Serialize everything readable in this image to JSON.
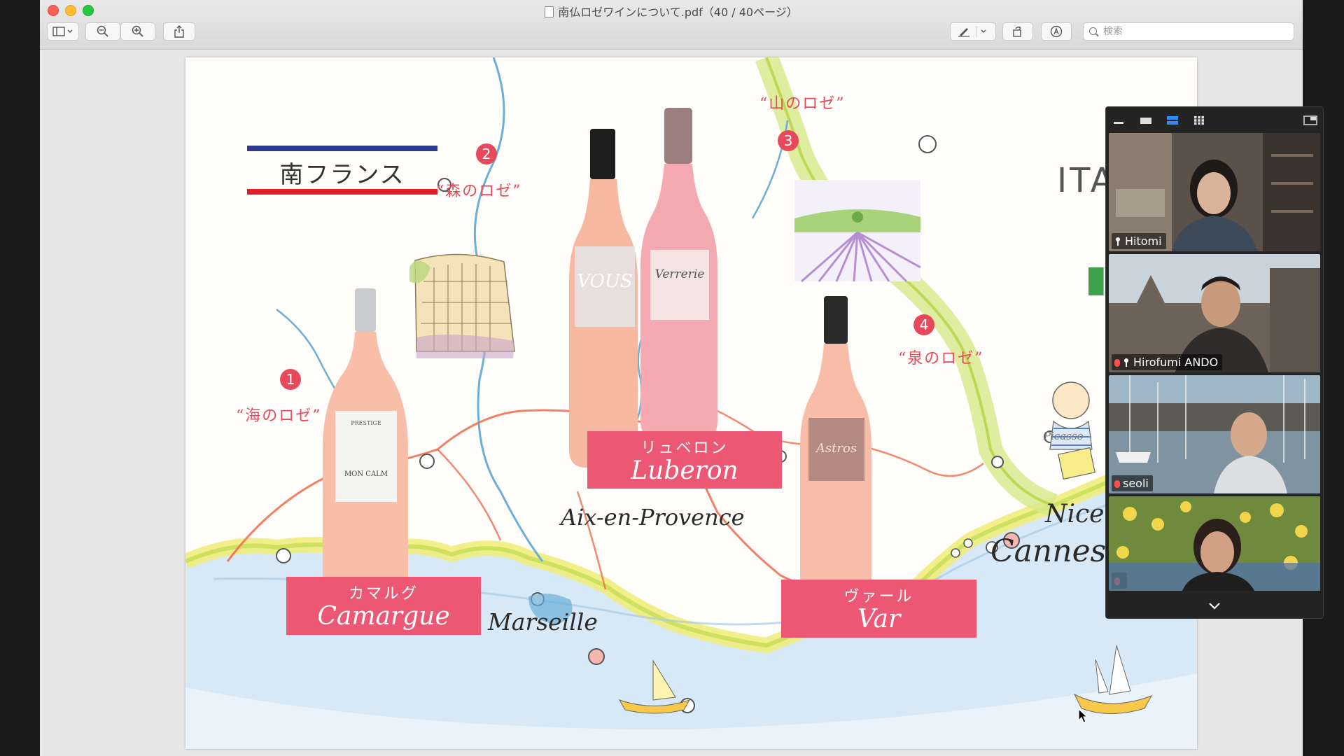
{
  "window": {
    "title": "南仏ロゼワインについて.pdf（40 / 40ページ）",
    "search_placeholder": "検索"
  },
  "page": {
    "heading": "南フランス",
    "labels": [
      {
        "num": "1",
        "tag": "“海のロゼ”"
      },
      {
        "num": "2",
        "tag": "“森のロゼ”"
      },
      {
        "num": "3",
        "tag": "“山のロゼ”"
      },
      {
        "num": "4",
        "tag": "“泉のロゼ”"
      }
    ],
    "regions": [
      {
        "jp": "カマルグ",
        "en": "Camargue"
      },
      {
        "jp": "リュベロン",
        "en": "Luberon"
      },
      {
        "jp": "ヴァール",
        "en": "Var"
      }
    ],
    "cities": {
      "aix": "Aix-en-Provence",
      "marseille": "Marseille",
      "nice": "Nice",
      "cannes": "Cannes"
    },
    "italia": "ITALI",
    "picasso": "Picasso",
    "wine_labels": {
      "prestige": "PRESTIGE",
      "moncalm": "MON CALM",
      "vous": "VOUS",
      "verrerie": "Verrerie",
      "astros": "Astros"
    }
  },
  "zoom": {
    "participants": [
      {
        "name": "Hitomi"
      },
      {
        "name": "Hirofumi ANDO"
      },
      {
        "name": "seoli"
      },
      {
        "name": ""
      }
    ]
  },
  "colors": {
    "accent_pink": "#ec5874",
    "number_red": "#e8495a",
    "flag_blue": "#2d3b8f",
    "flag_red": "#e21e2b"
  }
}
